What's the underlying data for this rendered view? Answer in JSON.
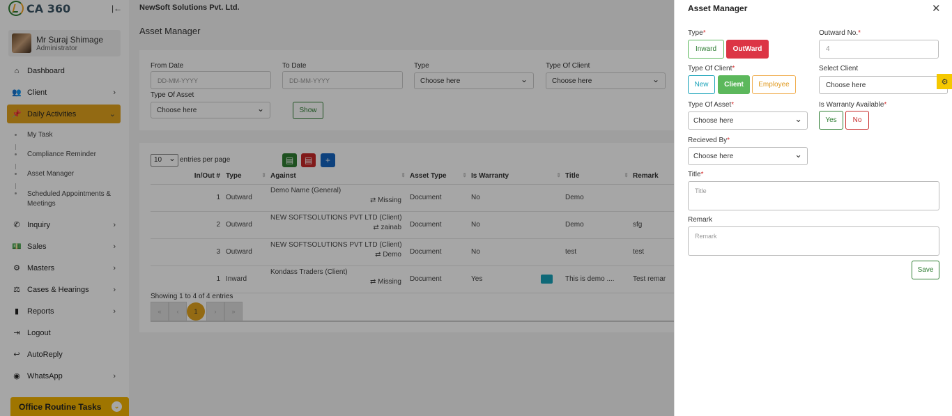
{
  "app": {
    "logo": "CA 360",
    "company": "NewSoft Solutions Pvt. Ltd."
  },
  "user": {
    "name": "Mr Suraj Shimage",
    "role": "Administrator"
  },
  "sidebar": {
    "items": [
      {
        "label": "Dashboard"
      },
      {
        "label": "Client"
      },
      {
        "label": "Daily Activities"
      },
      {
        "label": "Inquiry"
      },
      {
        "label": "Sales"
      },
      {
        "label": "Masters"
      },
      {
        "label": "Cases & Hearings"
      },
      {
        "label": "Reports"
      },
      {
        "label": "Logout"
      },
      {
        "label": "AutoReply"
      },
      {
        "label": "WhatsApp"
      }
    ],
    "sub": [
      {
        "label": "My Task"
      },
      {
        "label": "Compliance Reminder"
      },
      {
        "label": "Asset Manager"
      },
      {
        "label": "Scheduled Appointments & Meetings"
      }
    ],
    "routine": "Office Routine Tasks"
  },
  "page": {
    "title": "Asset Manager"
  },
  "filters": {
    "from_label": "From Date",
    "from_ph": "DD-MM-YYYY",
    "to_label": "To Date",
    "to_ph": "DD-MM-YYYY",
    "type_label": "Type",
    "type_val": "Choose here",
    "toc_label": "Type Of Client",
    "toc_val": "Choose here",
    "toa_label": "Type Of Asset",
    "toa_val": "Choose here",
    "show": "Show"
  },
  "table": {
    "entries_val": "10",
    "entries_label": "entries per page",
    "headers": [
      "In/Out #",
      "Type",
      "Against",
      "Asset Type",
      "Is Warranty",
      "Title",
      "Remark"
    ],
    "rows": [
      {
        "num": "1",
        "type": "Outward",
        "against": "Demo Name (General)",
        "by": "⇄ Missing",
        "asset": "Document",
        "warranty": "No",
        "title": "Demo",
        "remark": ""
      },
      {
        "num": "2",
        "type": "Outward",
        "against": "NEW SOFTSOLUTIONS PVT LTD (Client)",
        "by": "⇄ zainab",
        "asset": "Document",
        "warranty": "No",
        "title": "Demo",
        "remark": "sfg"
      },
      {
        "num": "3",
        "type": "Outward",
        "against": "NEW SOFTSOLUTIONS PVT LTD (Client)",
        "by": "⇄ Demo",
        "asset": "Document",
        "warranty": "No",
        "title": "test",
        "remark": "test"
      },
      {
        "num": "1",
        "type": "Inward",
        "against": "Kondass Traders (Client)",
        "by": "⇄ Missing",
        "asset": "Document",
        "warranty": "Yes",
        "title": "This is demo ....",
        "remark": "Test remar"
      }
    ],
    "showing": "Showing 1 to 4 of 4 entries",
    "pager": {
      "first": "«",
      "prev": "‹",
      "current": "1",
      "next": "›",
      "last": "»"
    }
  },
  "modal": {
    "title": "Asset Manager",
    "type_label": "Type",
    "inward": "Inward",
    "outward": "OutWard",
    "outward_no_label": "Outward No.",
    "outward_no_val": "4",
    "toc_label": "Type Of Client",
    "new": "New",
    "client": "Client",
    "employee": "Employee",
    "select_client_label": "Select Client",
    "select_client_ph": "Choose here",
    "toa_label": "Type Of Asset",
    "toa_val": "Choose here",
    "warranty_label": "Is Warranty Available",
    "yes": "Yes",
    "no": "No",
    "received_label": "Recieved By",
    "received_val": "Choose here",
    "title_label": "Title",
    "title_ph": "Title",
    "remark_label": "Remark",
    "remark_ph": "Remark",
    "save": "Save"
  },
  "colors": {
    "accent": "#e2a31e",
    "danger": "#dc3545",
    "success": "#5cb85c",
    "info": "#17a2b8",
    "warning": "#f0ad4e"
  }
}
